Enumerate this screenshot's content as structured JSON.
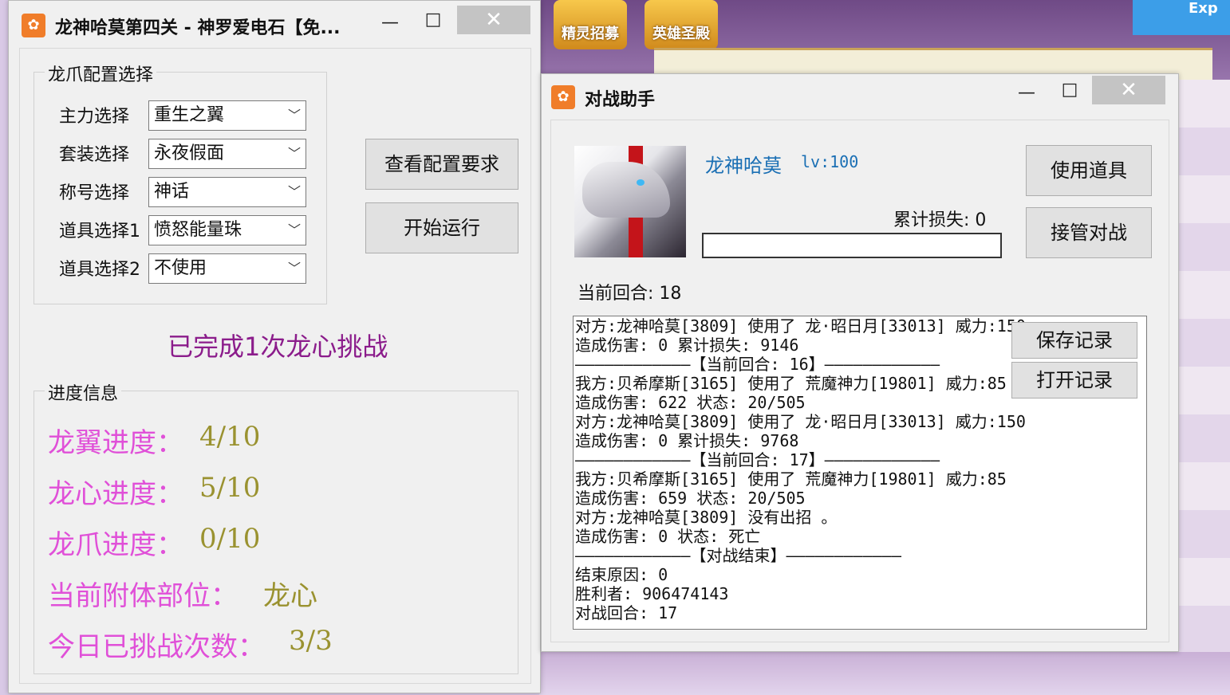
{
  "game": {
    "buttons": [
      "精灵招募",
      "英雄圣殿"
    ],
    "corner_text": "Exp"
  },
  "config_window": {
    "title": "龙神哈莫第四关 - 神罗爱电石【免...",
    "minimize": "—",
    "maximize": "□",
    "close": "✕",
    "group_title": "龙爪配置选择",
    "fields": [
      {
        "label": "主力选择",
        "value": "重生之翼"
      },
      {
        "label": "套装选择",
        "value": "永夜假面"
      },
      {
        "label": "称号选择",
        "value": "神话"
      },
      {
        "label": "道具选择1",
        "value": "愤怒能量珠"
      },
      {
        "label": "道具选择2",
        "value": "不使用"
      }
    ],
    "view_config_button": "查看配置要求",
    "start_button": "开始运行",
    "status_message": "已完成1次龙心挑战",
    "progress_group_title": "进度信息",
    "progress": [
      {
        "label": "龙翼进度：",
        "value": "4/10"
      },
      {
        "label": "龙心进度：",
        "value": "5/10"
      },
      {
        "label": "龙爪进度：",
        "value": "0/10"
      },
      {
        "label": "当前附体部位：",
        "value": "龙心"
      },
      {
        "label": "今日已挑战次数：",
        "value": "3/3"
      }
    ]
  },
  "battle_window": {
    "title": "对战助手",
    "minimize": "—",
    "maximize": "□",
    "close": "✕",
    "boss_name": "龙神哈莫",
    "boss_level": "lv:100",
    "cumulative_loss": "累计损失: 0",
    "hp_fraction": 0,
    "use_item_button": "使用道具",
    "takeover_button": "接管对战",
    "current_round": "当前回合: 18",
    "save_log_button": "保存记录",
    "open_log_button": "打开记录",
    "log_lines": [
      "对方:龙神哈莫[3809] 使用了 龙·昭日月[33013] 威力:150",
      "造成伤害: 0 累计损失: 9146",
      "————————————【当前回合: 16】————————————",
      "我方:贝希摩斯[3165] 使用了 荒魔神力[19801] 威力:85",
      "造成伤害: 622 状态: 20/505",
      "对方:龙神哈莫[3809] 使用了 龙·昭日月[33013] 威力:150",
      "造成伤害: 0 累计损失: 9768",
      "————————————【当前回合: 17】————————————",
      "我方:贝希摩斯[3165] 使用了 荒魔神力[19801] 威力:85",
      "造成伤害: 659 状态: 20/505",
      "对方:龙神哈莫[3809] 没有出招 。",
      "造成伤害: 0 状态: 死亡",
      "————————————【对战结束】————————————",
      "结束原因: 0",
      "胜利者: 906474143",
      "对战回合: 17"
    ]
  }
}
